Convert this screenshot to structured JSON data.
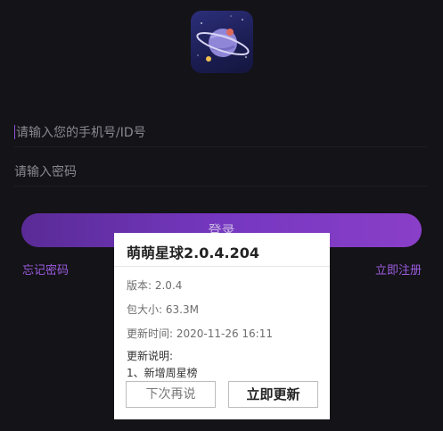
{
  "login": {
    "phone_placeholder": "请输入您的手机号/ID号",
    "password_placeholder": "请输入密码",
    "login_label": "登录",
    "forgot_password": "忘记密码",
    "register": "立即注册"
  },
  "update_dialog": {
    "title": "萌萌星球2.0.4.204",
    "version": "版本: 2.0.4",
    "size": "包大小: 63.3M",
    "update_time": "更新时间: 2020-11-26 16:11",
    "notes_title": "更新说明:",
    "notes": [
      "1、新增周星榜"
    ],
    "later_label": "下次再说",
    "update_label": "立即更新"
  },
  "colors": {
    "background": "#141317",
    "accent": "#7a38c4",
    "link": "#9b5ce0",
    "dialog_bg": "#ffffff"
  },
  "icons": {
    "logo": "planet-logo-icon"
  }
}
